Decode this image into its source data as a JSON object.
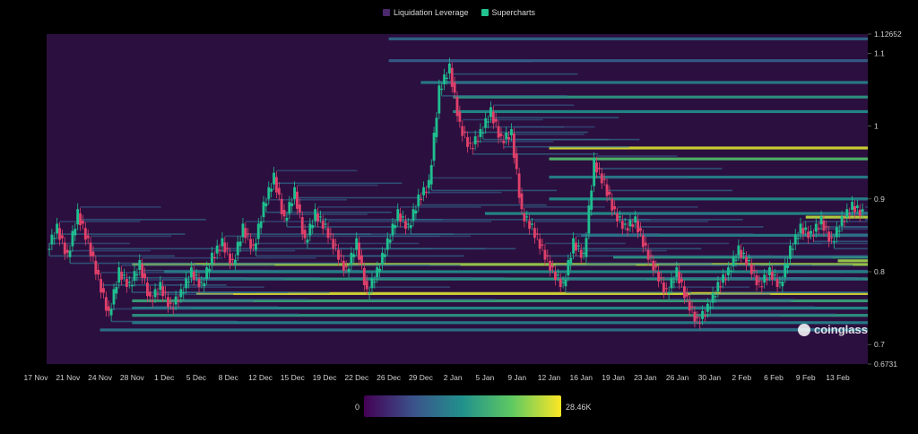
{
  "legend": {
    "items": [
      {
        "label": "Liquidation Leverage",
        "color": "#4b2a6b"
      },
      {
        "label": "Supercharts",
        "color": "#22c38e"
      }
    ]
  },
  "colors": {
    "background": "#000000",
    "heatmap_base": "#2b0f3f",
    "up": "#1fbf8f",
    "down": "#e0406a",
    "low": "#440154",
    "mid": "#21918c",
    "high": "#fde725"
  },
  "colorbar": {
    "min_label": "0",
    "max_label": "28.46K"
  },
  "watermark": {
    "text": "coinglass",
    "icon": "coinglass-logo-icon"
  },
  "chart_data": {
    "type": "heatmap",
    "ylim": [
      0.6731,
      1.12652
    ],
    "y_ticks": [
      "1.12652",
      "1.1",
      "1",
      "0.9",
      "0.8",
      "0.7",
      "0.6731"
    ],
    "y_tick_values": [
      1.12652,
      1.1,
      1.0,
      0.9,
      0.8,
      0.7,
      0.6731
    ],
    "x_ticks": [
      "17 Nov",
      "21 Nov",
      "24 Nov",
      "28 Nov",
      "1 Dec",
      "5 Dec",
      "8 Dec",
      "12 Dec",
      "15 Dec",
      "19 Dec",
      "22 Dec",
      "26 Dec",
      "29 Dec",
      "2 Jan",
      "5 Jan",
      "9 Jan",
      "12 Jan",
      "16 Jan",
      "19 Jan",
      "23 Jan",
      "26 Jan",
      "30 Jan",
      "2 Feb",
      "6 Feb",
      "9 Feb",
      "13 Feb"
    ],
    "price_path": [
      0.83,
      0.86,
      0.82,
      0.88,
      0.84,
      0.79,
      0.74,
      0.8,
      0.78,
      0.81,
      0.76,
      0.78,
      0.75,
      0.77,
      0.8,
      0.78,
      0.82,
      0.84,
      0.81,
      0.86,
      0.83,
      0.89,
      0.93,
      0.87,
      0.91,
      0.84,
      0.88,
      0.86,
      0.83,
      0.8,
      0.84,
      0.77,
      0.8,
      0.84,
      0.88,
      0.86,
      0.9,
      0.92,
      1.05,
      1.08,
      1.0,
      0.97,
      0.99,
      1.02,
      0.98,
      0.99,
      0.88,
      0.86,
      0.83,
      0.8,
      0.78,
      0.84,
      0.82,
      0.95,
      0.92,
      0.88,
      0.86,
      0.87,
      0.83,
      0.8,
      0.77,
      0.8,
      0.76,
      0.73,
      0.75,
      0.78,
      0.8,
      0.83,
      0.81,
      0.78,
      0.8,
      0.78,
      0.83,
      0.86,
      0.85,
      0.87,
      0.84,
      0.87,
      0.89,
      0.88
    ],
    "liquidation_bands": [
      {
        "price": 1.12,
        "x_start": "26 Dec",
        "intensity": 0.35
      },
      {
        "price": 1.09,
        "x_start": "26 Dec",
        "intensity": 0.3
      },
      {
        "price": 1.06,
        "x_start": "29 Dec",
        "intensity": 0.45
      },
      {
        "price": 1.04,
        "x_start": "2 Jan",
        "intensity": 0.55
      },
      {
        "price": 1.02,
        "x_start": "2 Jan",
        "intensity": 0.5
      },
      {
        "price": 0.97,
        "x_start": "12 Jan",
        "intensity": 0.95
      },
      {
        "price": 0.955,
        "x_start": "12 Jan",
        "intensity": 0.7
      },
      {
        "price": 0.93,
        "x_start": "12 Jan",
        "intensity": 0.45
      },
      {
        "price": 0.9,
        "x_start": "12 Jan",
        "intensity": 0.5
      },
      {
        "price": 0.88,
        "x_start": "5 Jan",
        "intensity": 0.5
      },
      {
        "price": 0.85,
        "x_start": "16 Jan",
        "intensity": 0.45
      },
      {
        "price": 0.82,
        "x_start": "19 Jan",
        "intensity": 0.55
      },
      {
        "price": 0.81,
        "x_start": "28 Nov",
        "intensity": 0.85
      },
      {
        "price": 0.8,
        "x_start": "1 Dec",
        "intensity": 0.5
      },
      {
        "price": 0.79,
        "x_start": "5 Dec",
        "intensity": 0.55
      },
      {
        "price": 0.77,
        "x_start": "5 Dec",
        "intensity": 0.95
      },
      {
        "price": 0.76,
        "x_start": "28 Nov",
        "intensity": 0.6
      },
      {
        "price": 0.75,
        "x_start": "28 Nov",
        "intensity": 0.5
      },
      {
        "price": 0.74,
        "x_start": "28 Nov",
        "intensity": 0.55
      },
      {
        "price": 0.73,
        "x_start": "28 Nov",
        "intensity": 0.45
      },
      {
        "price": 0.72,
        "x_start": "24 Nov",
        "intensity": 0.4
      },
      {
        "price": 0.875,
        "x_start": "9 Feb",
        "intensity": 0.9
      },
      {
        "price": 0.815,
        "x_start": "13 Feb",
        "intensity": 0.85
      }
    ]
  }
}
